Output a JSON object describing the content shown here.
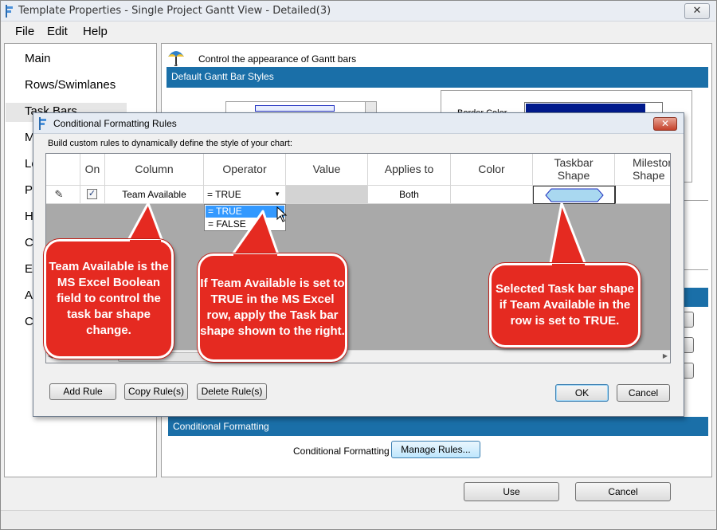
{
  "window": {
    "title": "Template Properties - Single Project Gantt View - Detailed(3)",
    "close_glyph": "✕"
  },
  "menu": [
    "File",
    "Edit",
    "Help"
  ],
  "nav": [
    "Main",
    "Rows/Swimlanes",
    "Task Bars",
    "M",
    "Le",
    "P",
    "H",
    "C",
    "E",
    "A",
    "C"
  ],
  "main": {
    "header_text": "Control the appearance of Gantt bars",
    "section_default": "Default Gantt Bar Styles",
    "border_color_label": "Border Color",
    "section_conditional": "Conditional Formatting",
    "cond_label": "Conditional Formatting",
    "manage_rules": "Manage Rules..."
  },
  "footer": {
    "use": "Use",
    "cancel": "Cancel"
  },
  "dialog": {
    "title": "Conditional Formatting Rules",
    "subtitle": "Build custom rules to dynamically define the style of your chart:",
    "columns": [
      "On",
      "Column",
      "Operator",
      "Value",
      "Applies to",
      "Color",
      "Taskbar\nShape",
      "Mileston\nShape"
    ],
    "row": {
      "pencil": "✎",
      "checked": "✓",
      "column": "Team Available",
      "operator": "= TRUE",
      "applies_to": "Both"
    },
    "dropdown_options": [
      "= TRUE",
      "= FALSE"
    ],
    "buttons": {
      "add": "Add Rule",
      "copy": "Copy Rule(s)",
      "delete": "Delete Rule(s)",
      "ok": "OK",
      "cancel": "Cancel"
    }
  },
  "callouts": [
    "Team Available is the MS Excel Boolean field to control the task bar shape change.",
    "If Team Available is set to TRUE in the MS Excel row, apply the Task bar shape shown to the right.",
    "Selected Task bar shape if Team Available in the row is set to TRUE."
  ],
  "colors": {
    "accent_blue": "#1a6fa8",
    "callout_red": "#e52a21",
    "shape_fill": "#a9d8f0",
    "border_color_swatch": "#001a8c"
  }
}
